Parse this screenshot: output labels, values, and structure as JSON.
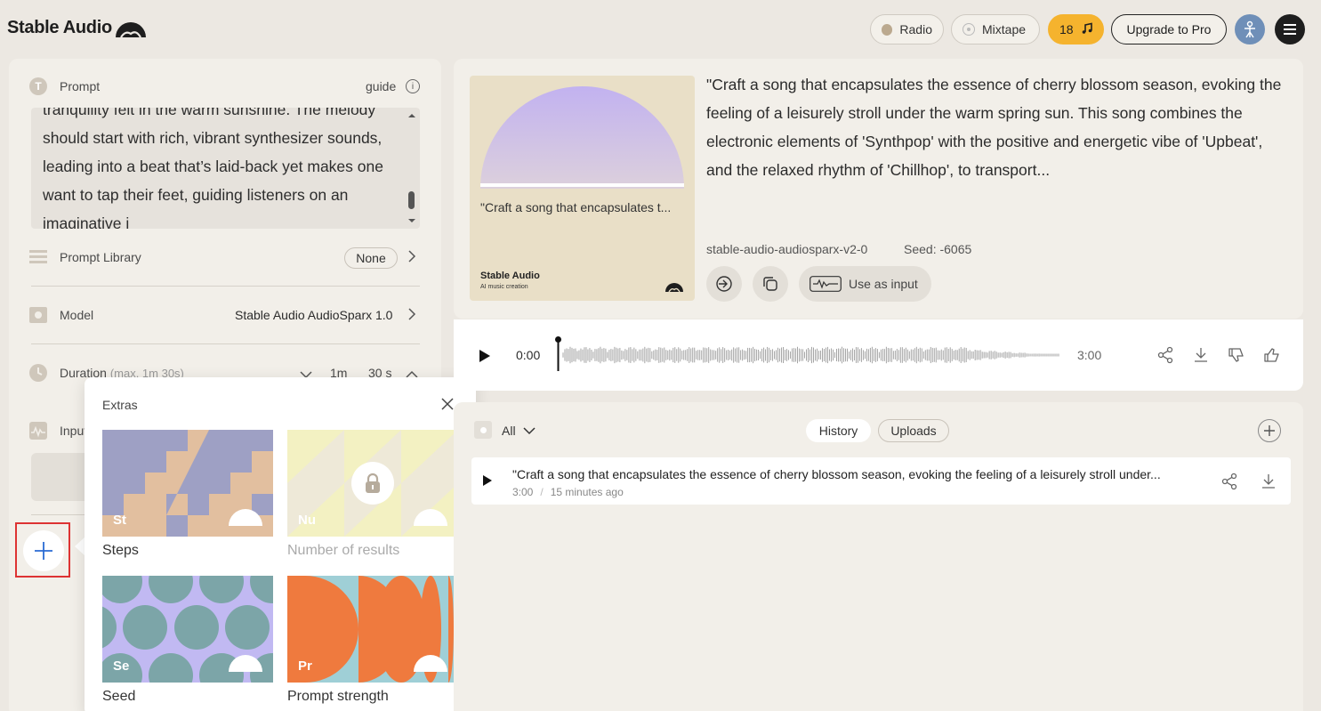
{
  "header": {
    "logo": "Stable Audio",
    "radio_label": "Radio",
    "mixtape_label": "Mixtape",
    "credits": "18",
    "upgrade_label": "Upgrade to Pro"
  },
  "left": {
    "prompt_label": "Prompt",
    "guide_label": "guide",
    "prompt_text": "tranquility felt in the warm sunshine. The melody should start with rich, vibrant synthesizer sounds, leading into a beat that’s laid-back yet makes one want to tap their feet, guiding listeners on an imaginative j",
    "library_label": "Prompt Library",
    "library_value": "None",
    "model_label": "Model",
    "model_value": "Stable Audio AudioSparx 1.0",
    "duration_label": "Duration",
    "duration_hint": "(max. 1m 30s)",
    "duration_min": "1m",
    "duration_sec": "30 s",
    "input_label": "Input"
  },
  "extras": {
    "title": "Extras",
    "tiles": [
      {
        "abbr": "St",
        "label": "Steps"
      },
      {
        "abbr": "Nu",
        "label": "Number of results"
      },
      {
        "abbr": "Se",
        "label": "Seed"
      },
      {
        "abbr": "Pr",
        "label": "Prompt strength"
      }
    ]
  },
  "track": {
    "album_caption": "\"Craft a song that encapsulates t...",
    "album_brand": "Stable Audio",
    "album_sub": "AI music creation",
    "description": "\"Craft a song that encapsulates the essence of cherry blossom season, evoking the feeling of a leisurely stroll under the warm spring sun. This song combines the electronic elements of 'Synthpop' with the positive and energetic vibe of 'Upbeat', and the relaxed rhythm of 'Chillhop', to transport...",
    "model_id": "stable-audio-audiosparx-v2-0",
    "seed": "Seed: -6065",
    "use_as_input": "Use as input",
    "current_time": "0:00",
    "total_time": "3:00",
    "progress": 0
  },
  "history": {
    "filter": "All",
    "tabs": [
      "History",
      "Uploads"
    ],
    "items": [
      {
        "title": "\"Craft a song that encapsulates the essence of cherry blossom season, evoking the feeling of a leisurely stroll under...",
        "duration": "3:00",
        "separator": "/",
        "age": "15 minutes ago"
      }
    ]
  }
}
